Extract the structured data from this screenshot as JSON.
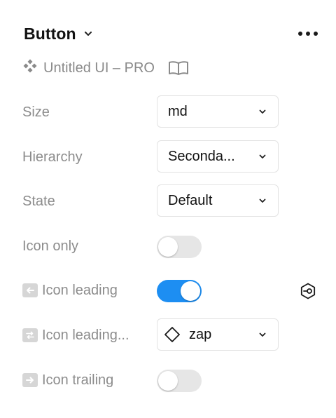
{
  "header": {
    "title": "Button",
    "chevron_icon": "chevron-down-icon",
    "more_icon": "more-horizontal-icon"
  },
  "library": {
    "icon": "component-icon",
    "name": "Untitled UI – PRO",
    "book_icon": "book-icon"
  },
  "properties": {
    "size": {
      "label": "Size",
      "value": "md"
    },
    "hierarchy": {
      "label": "Hierarchy",
      "value": "Seconda..."
    },
    "state": {
      "label": "State",
      "value": "Default"
    },
    "icon_only": {
      "label": "Icon only",
      "on": false
    },
    "icon_leading": {
      "label": "Icon leading",
      "on": true,
      "side_icon": "disconnect-icon"
    },
    "icon_leading_swap": {
      "label": "Icon leading...",
      "value": "zap",
      "value_icon": "diamond-icon"
    },
    "icon_trailing": {
      "label": "Icon trailing",
      "on": false
    }
  },
  "colors": {
    "toggle_on": "#1d8ef2",
    "toggle_off": "#e6e6e6",
    "label": "#8c8c8c"
  }
}
